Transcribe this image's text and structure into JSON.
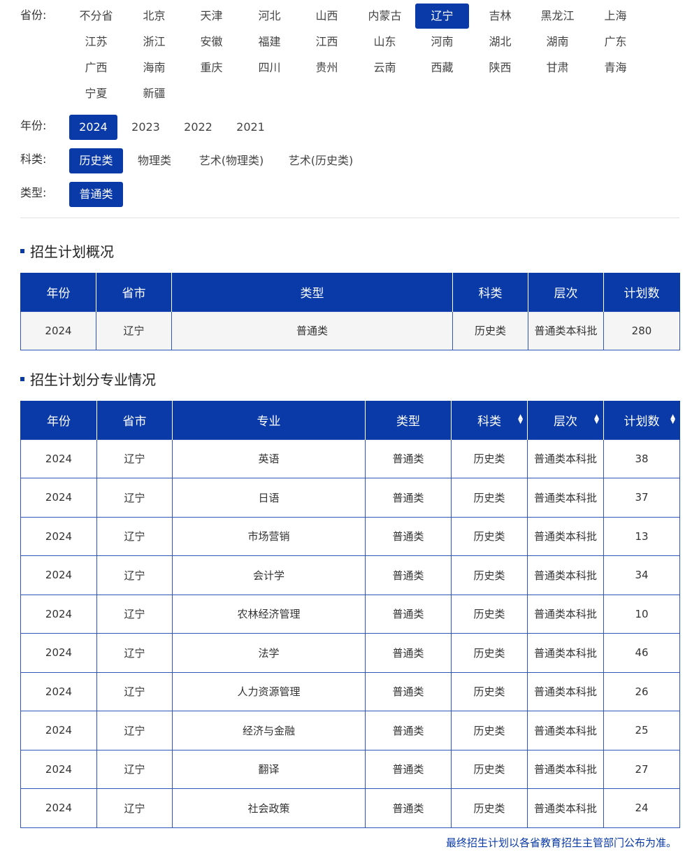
{
  "filters": {
    "province": {
      "label": "省份:",
      "options": [
        "不分省",
        "北京",
        "天津",
        "河北",
        "山西",
        "内蒙古",
        "辽宁",
        "吉林",
        "黑龙江",
        "上海",
        "江苏",
        "浙江",
        "安徽",
        "福建",
        "江西",
        "山东",
        "河南",
        "湖北",
        "湖南",
        "广东",
        "广西",
        "海南",
        "重庆",
        "四川",
        "贵州",
        "云南",
        "西藏",
        "陕西",
        "甘肃",
        "青海",
        "宁夏",
        "新疆"
      ],
      "selected": "辽宁"
    },
    "year": {
      "label": "年份:",
      "options": [
        "2024",
        "2023",
        "2022",
        "2021"
      ],
      "selected": "2024"
    },
    "subject": {
      "label": "科类:",
      "options": [
        "历史类",
        "物理类",
        "艺术(物理类)",
        "艺术(历史类)"
      ],
      "selected": "历史类"
    },
    "type": {
      "label": "类型:",
      "options": [
        "普通类"
      ],
      "selected": "普通类"
    }
  },
  "overview": {
    "title": "招生计划概况",
    "headers": [
      "年份",
      "省市",
      "类型",
      "科类",
      "层次",
      "计划数"
    ],
    "row": [
      "2024",
      "辽宁",
      "普通类",
      "历史类",
      "普通类本科批",
      "280"
    ]
  },
  "majors": {
    "title": "招生计划分专业情况",
    "headers": [
      "年份",
      "省市",
      "专业",
      "类型",
      "科类",
      "层次",
      "计划数"
    ],
    "sortable": [
      false,
      false,
      false,
      false,
      true,
      true,
      true
    ],
    "rows": [
      [
        "2024",
        "辽宁",
        "英语",
        "普通类",
        "历史类",
        "普通类本科批",
        "38"
      ],
      [
        "2024",
        "辽宁",
        "日语",
        "普通类",
        "历史类",
        "普通类本科批",
        "37"
      ],
      [
        "2024",
        "辽宁",
        "市场营销",
        "普通类",
        "历史类",
        "普通类本科批",
        "13"
      ],
      [
        "2024",
        "辽宁",
        "会计学",
        "普通类",
        "历史类",
        "普通类本科批",
        "34"
      ],
      [
        "2024",
        "辽宁",
        "农林经济管理",
        "普通类",
        "历史类",
        "普通类本科批",
        "10"
      ],
      [
        "2024",
        "辽宁",
        "法学",
        "普通类",
        "历史类",
        "普通类本科批",
        "46"
      ],
      [
        "2024",
        "辽宁",
        "人力资源管理",
        "普通类",
        "历史类",
        "普通类本科批",
        "26"
      ],
      [
        "2024",
        "辽宁",
        "经济与金融",
        "普通类",
        "历史类",
        "普通类本科批",
        "25"
      ],
      [
        "2024",
        "辽宁",
        "翻译",
        "普通类",
        "历史类",
        "普通类本科批",
        "27"
      ],
      [
        "2024",
        "辽宁",
        "社会政策",
        "普通类",
        "历史类",
        "普通类本科批",
        "24"
      ]
    ]
  },
  "footer_note": "最终招生计划以各省教育招生主管部门公布为准。",
  "colors": {
    "accent": "#0a3aa8",
    "border": "#2f55b8"
  },
  "icons": {
    "sort": "sort-updown-icon",
    "section_marker": "square-bullet-icon"
  }
}
